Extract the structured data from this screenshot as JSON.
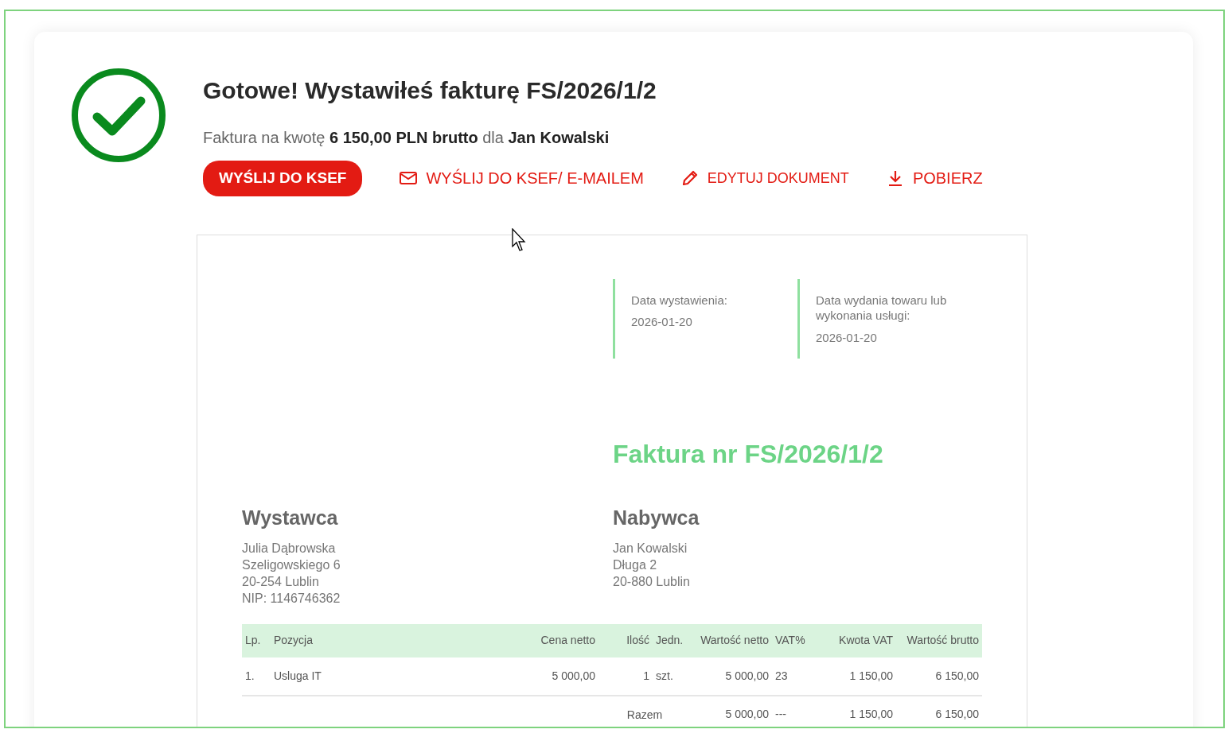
{
  "header": {
    "title": "Gotowe! Wystawiłeś fakturę FS/2026/1/2",
    "summary": "Faktura na kwotę **6 150,00 PLN brutto** dla **Jan Kowalski**"
  },
  "actions": [
    {
      "label": "WYŚLIJ DO KSEF",
      "kind": "primary"
    },
    {
      "label": "WYŚLIJ DO KSEF/ E-MAILEM",
      "kind": "mail"
    },
    {
      "label": "EDYTUJ DOKUMENT",
      "kind": "edit"
    },
    {
      "label": "POBIERZ",
      "kind": "download"
    }
  ],
  "invoice": {
    "dates": [
      {
        "label": "Data wystawienia:",
        "value": "2026-01-20"
      },
      {
        "label": "Data wydania towaru lub wykonania usługi:",
        "value": "2026-01-20"
      }
    ],
    "title": "Faktura nr FS/2026/1/2",
    "seller": {
      "heading": "Wystawca",
      "lines": [
        "Julia Dąbrowska",
        "Szeligowskiego 6",
        "20-254 Lublin",
        "NIP: 1146746362"
      ]
    },
    "buyer": {
      "heading": "Nabywca",
      "lines": [
        "Jan Kowalski",
        "Długa 2",
        "20-880 Lublin"
      ]
    },
    "table": {
      "columns": [
        "Lp.",
        "Pozycja",
        "Cena netto",
        "Ilość",
        "Jedn.",
        "Wartość netto",
        "VAT%",
        "Kwota VAT",
        "Wartość brutto"
      ],
      "rows": [
        [
          "1.",
          "Usluga IT",
          "5 000,00",
          "1",
          "szt.",
          "5 000,00",
          "23",
          "1 150,00",
          "6 150,00"
        ]
      ],
      "totals": [
        {
          "label": "Razem",
          "values": [
            "5 000,00",
            "---",
            "1 150,00",
            "6 150,00"
          ]
        }
      ]
    }
  }
}
